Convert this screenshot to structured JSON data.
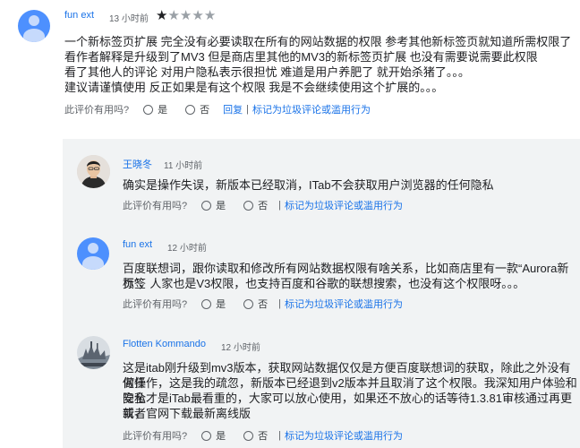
{
  "main_review": {
    "author": "fun ext",
    "time": "13 小时前",
    "rating": 1,
    "rating_max": 5,
    "lines": [
      "一个新标签页扩展 完全没有必要读取在所有的网站数据的权限 参考其他新标签页就知道所需权限了",
      "看作者解释是升级到了MV3 但是商店里其他的MV3的新标签页扩展 也没有需要说需要此权限",
      "看了其他人的评论 对用户隐私表示很担忧 难道是用户养肥了 就开始杀猪了。。。",
      "建议请谨慎使用 反正如果是有这个权限 我是不会继续使用这个扩展的。。。"
    ],
    "helpful_label": "此评价有用吗?",
    "yes_label": "是",
    "no_label": "否",
    "reply_link": "回复",
    "report_link": "标记为垃圾评论或滥用行为"
  },
  "replies": [
    {
      "author": "王晓冬",
      "time": "11 小时前",
      "avatar": "photo",
      "lines": [
        "确实是操作失误，新版本已经取消，ITab不会获取用户浏览器的任何隐私"
      ],
      "helpful_label": "此评价有用吗?",
      "yes_label": "是",
      "no_label": "否",
      "report_link": "标记为垃圾评论或滥用行为"
    },
    {
      "author": "fun ext",
      "time": "12 小时前",
      "avatar": "default",
      "lines": [
        "百度联想词，跟你读取和修改所有网站数据权限有啥关系，比如商店里有一款“Aurora新标签",
        "页”，人家也是V3权限，也支持百度和谷歌的联想搜索，也没有这个权限呀。。。"
      ],
      "helpful_label": "此评价有用吗?",
      "yes_label": "是",
      "no_label": "否",
      "report_link": "标记为垃圾评论或滥用行为"
    },
    {
      "author": "Flotten Kommando",
      "time": "12 小时前",
      "avatar": "photo",
      "lines": [
        "这是itab刚升级到mv3版本，获取网站数据仅仅是方便百度联想词的获取，除此之外没有做任",
        "何操作，这是我的疏忽，新版本已经退到v2版本并且取消了这个权限。我深知用户体验和隐私",
        "安全才是iTab最看重的，大家可以放心使用，如果还不放心的话等待1.3.81审核通过再更新，",
        "或者官网下载最新离线版"
      ],
      "helpful_label": "此评价有用吗?",
      "yes_label": "是",
      "no_label": "否",
      "report_link": "标记为垃圾评论或滥用行为"
    }
  ],
  "colors": {
    "link": "#1a73e8",
    "avatar_bg": "#4d90fe",
    "avatar_fg": "#c6dafc",
    "reply_bg": "#f1f3f4"
  }
}
